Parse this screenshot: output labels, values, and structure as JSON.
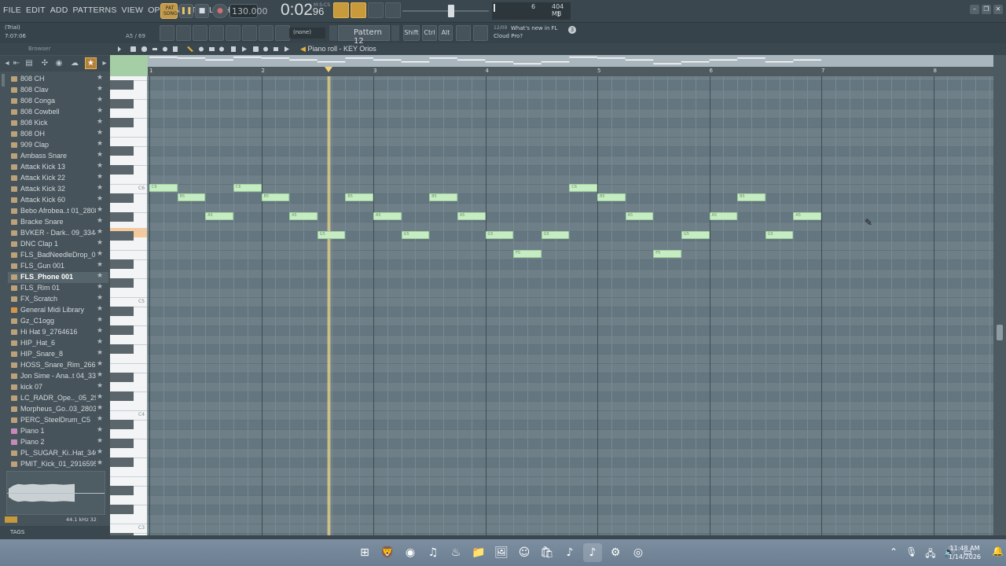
{
  "menu": [
    "FILE",
    "EDIT",
    "ADD",
    "PATTERNS",
    "VIEW",
    "OPTIONS",
    "TOOLS",
    "HELP"
  ],
  "transport": {
    "mode_label": "PAT\nSONG",
    "play_icon": "pause-icon",
    "stop_icon": "stop-icon",
    "record_icon": "record-icon",
    "tempo": "130.000",
    "time_main": "0:02",
    "time_sub": "96",
    "time_unit": "M:S:CS"
  },
  "cpu": {
    "cpu_value": "6",
    "memory": "404 MB",
    "voices": "1"
  },
  "status": {
    "trial": "(Trial)",
    "hint_time": "7:07:06",
    "note_info": "A5 / 69"
  },
  "pattern": {
    "none_label": "(none)",
    "name": "Pattern 12"
  },
  "modkeys": [
    "Shift",
    "Ctrl",
    "Alt"
  ],
  "news": {
    "date": "12/09",
    "line1": "What's new in FL",
    "line2": "Cloud Pro?",
    "badge": "3"
  },
  "browser": {
    "title": "Browser",
    "items": [
      {
        "label": "808 CH",
        "type": "folder"
      },
      {
        "label": "808 Clav",
        "type": "folder"
      },
      {
        "label": "808 Conga",
        "type": "folder"
      },
      {
        "label": "808 Cowbell",
        "type": "folder"
      },
      {
        "label": "808 Kick",
        "type": "folder"
      },
      {
        "label": "808 OH",
        "type": "folder"
      },
      {
        "label": "909 Clap",
        "type": "folder"
      },
      {
        "label": "Ambass Snare",
        "type": "folder"
      },
      {
        "label": "Attack Kick 13",
        "type": "folder"
      },
      {
        "label": "Attack Kick 22",
        "type": "folder"
      },
      {
        "label": "Attack Kick 32",
        "type": "folder"
      },
      {
        "label": "Attack Kick 60",
        "type": "folder"
      },
      {
        "label": "Bebo Afrobea..t 01_2808415",
        "type": "folder"
      },
      {
        "label": "Bracke Snare",
        "type": "folder"
      },
      {
        "label": "BVKER - Dark.. 09_3344274",
        "type": "folder"
      },
      {
        "label": "DNC Clap 1",
        "type": "folder"
      },
      {
        "label": "FLS_BadNeedleDrop_02",
        "type": "folder"
      },
      {
        "label": "FLS_Gun 001",
        "type": "folder"
      },
      {
        "label": "FLS_Phone 001",
        "type": "folder",
        "selected": true
      },
      {
        "label": "FLS_Rim 01",
        "type": "folder"
      },
      {
        "label": "FX_Scratch",
        "type": "folder"
      },
      {
        "label": "General Midi Library",
        "type": "orange"
      },
      {
        "label": "Gz_C1ogg",
        "type": "folder"
      },
      {
        "label": "Hi Hat 9_2764616",
        "type": "folder"
      },
      {
        "label": "HIP_Hat_6",
        "type": "folder"
      },
      {
        "label": "HIP_Snare_8",
        "type": "folder"
      },
      {
        "label": "HOSS_Snare_Rim_2665772",
        "type": "folder"
      },
      {
        "label": "Jon Sime - Ana..t 04_3348089",
        "type": "folder"
      },
      {
        "label": "kick 07",
        "type": "folder"
      },
      {
        "label": "LC_RADR_Ope.._05_2900079",
        "type": "folder"
      },
      {
        "label": "Morpheus_Go..03_2803027",
        "type": "folder"
      },
      {
        "label": "PERC_SteelDrum_C5",
        "type": "folder"
      },
      {
        "label": "Piano 1",
        "type": "pink"
      },
      {
        "label": "Piano 2",
        "type": "pink"
      },
      {
        "label": "PL_SUGAR_Ki..Hat_3408885",
        "type": "folder"
      },
      {
        "label": "PMIT_Kick_01_2916595",
        "type": "folder"
      }
    ],
    "sample_rate": "44.1 kHz 32",
    "tags_label": "TAGS"
  },
  "piano_roll": {
    "title": "Piano roll - KEY Orios",
    "bars": [
      "1",
      "2",
      "3",
      "4",
      "5",
      "6",
      "7",
      "8"
    ],
    "octave_labels": [
      "C6",
      "C5",
      "C4",
      "C3"
    ],
    "playhead_position_bars": 2.6,
    "notes": [
      {
        "bar": 1.0,
        "len": 0.25,
        "pitch": "C6"
      },
      {
        "bar": 1.25,
        "len": 0.25,
        "pitch": "B5"
      },
      {
        "bar": 1.5,
        "len": 0.25,
        "pitch": "A5"
      },
      {
        "bar": 1.75,
        "len": 0.25,
        "pitch": "C6"
      },
      {
        "bar": 2.0,
        "len": 0.25,
        "pitch": "B5"
      },
      {
        "bar": 2.25,
        "len": 0.25,
        "pitch": "A5"
      },
      {
        "bar": 2.5,
        "len": 0.25,
        "pitch": "G5"
      },
      {
        "bar": 2.75,
        "len": 0.25,
        "pitch": "B5"
      },
      {
        "bar": 3.0,
        "len": 0.25,
        "pitch": "A5"
      },
      {
        "bar": 3.25,
        "len": 0.25,
        "pitch": "G5"
      },
      {
        "bar": 3.5,
        "len": 0.25,
        "pitch": "B5"
      },
      {
        "bar": 3.75,
        "len": 0.25,
        "pitch": "A5"
      },
      {
        "bar": 4.0,
        "len": 0.25,
        "pitch": "G5"
      },
      {
        "bar": 4.25,
        "len": 0.25,
        "pitch": "F5"
      },
      {
        "bar": 4.5,
        "len": 0.25,
        "pitch": "G5"
      },
      {
        "bar": 4.75,
        "len": 0.25,
        "pitch": "C6"
      },
      {
        "bar": 5.0,
        "len": 0.25,
        "pitch": "B5"
      },
      {
        "bar": 5.25,
        "len": 0.25,
        "pitch": "A5"
      },
      {
        "bar": 5.5,
        "len": 0.25,
        "pitch": "F5"
      },
      {
        "bar": 5.75,
        "len": 0.25,
        "pitch": "G5"
      },
      {
        "bar": 6.0,
        "len": 0.25,
        "pitch": "A5"
      },
      {
        "bar": 6.25,
        "len": 0.25,
        "pitch": "B5"
      },
      {
        "bar": 6.5,
        "len": 0.25,
        "pitch": "G5"
      },
      {
        "bar": 6.75,
        "len": 0.25,
        "pitch": "A5"
      }
    ]
  },
  "taskbar": {
    "apps": [
      "windows-start-icon",
      "brave-icon",
      "chrome-icon",
      "spotify-icon",
      "steam-icon",
      "file-explorer-icon",
      "photos-icon",
      "discord-icon",
      "store-icon",
      "fl-studio-alt-icon",
      "fl-studio-icon",
      "settings-icon",
      "obs-icon"
    ],
    "time": "11:48 AM",
    "date": "1/14/2026"
  }
}
